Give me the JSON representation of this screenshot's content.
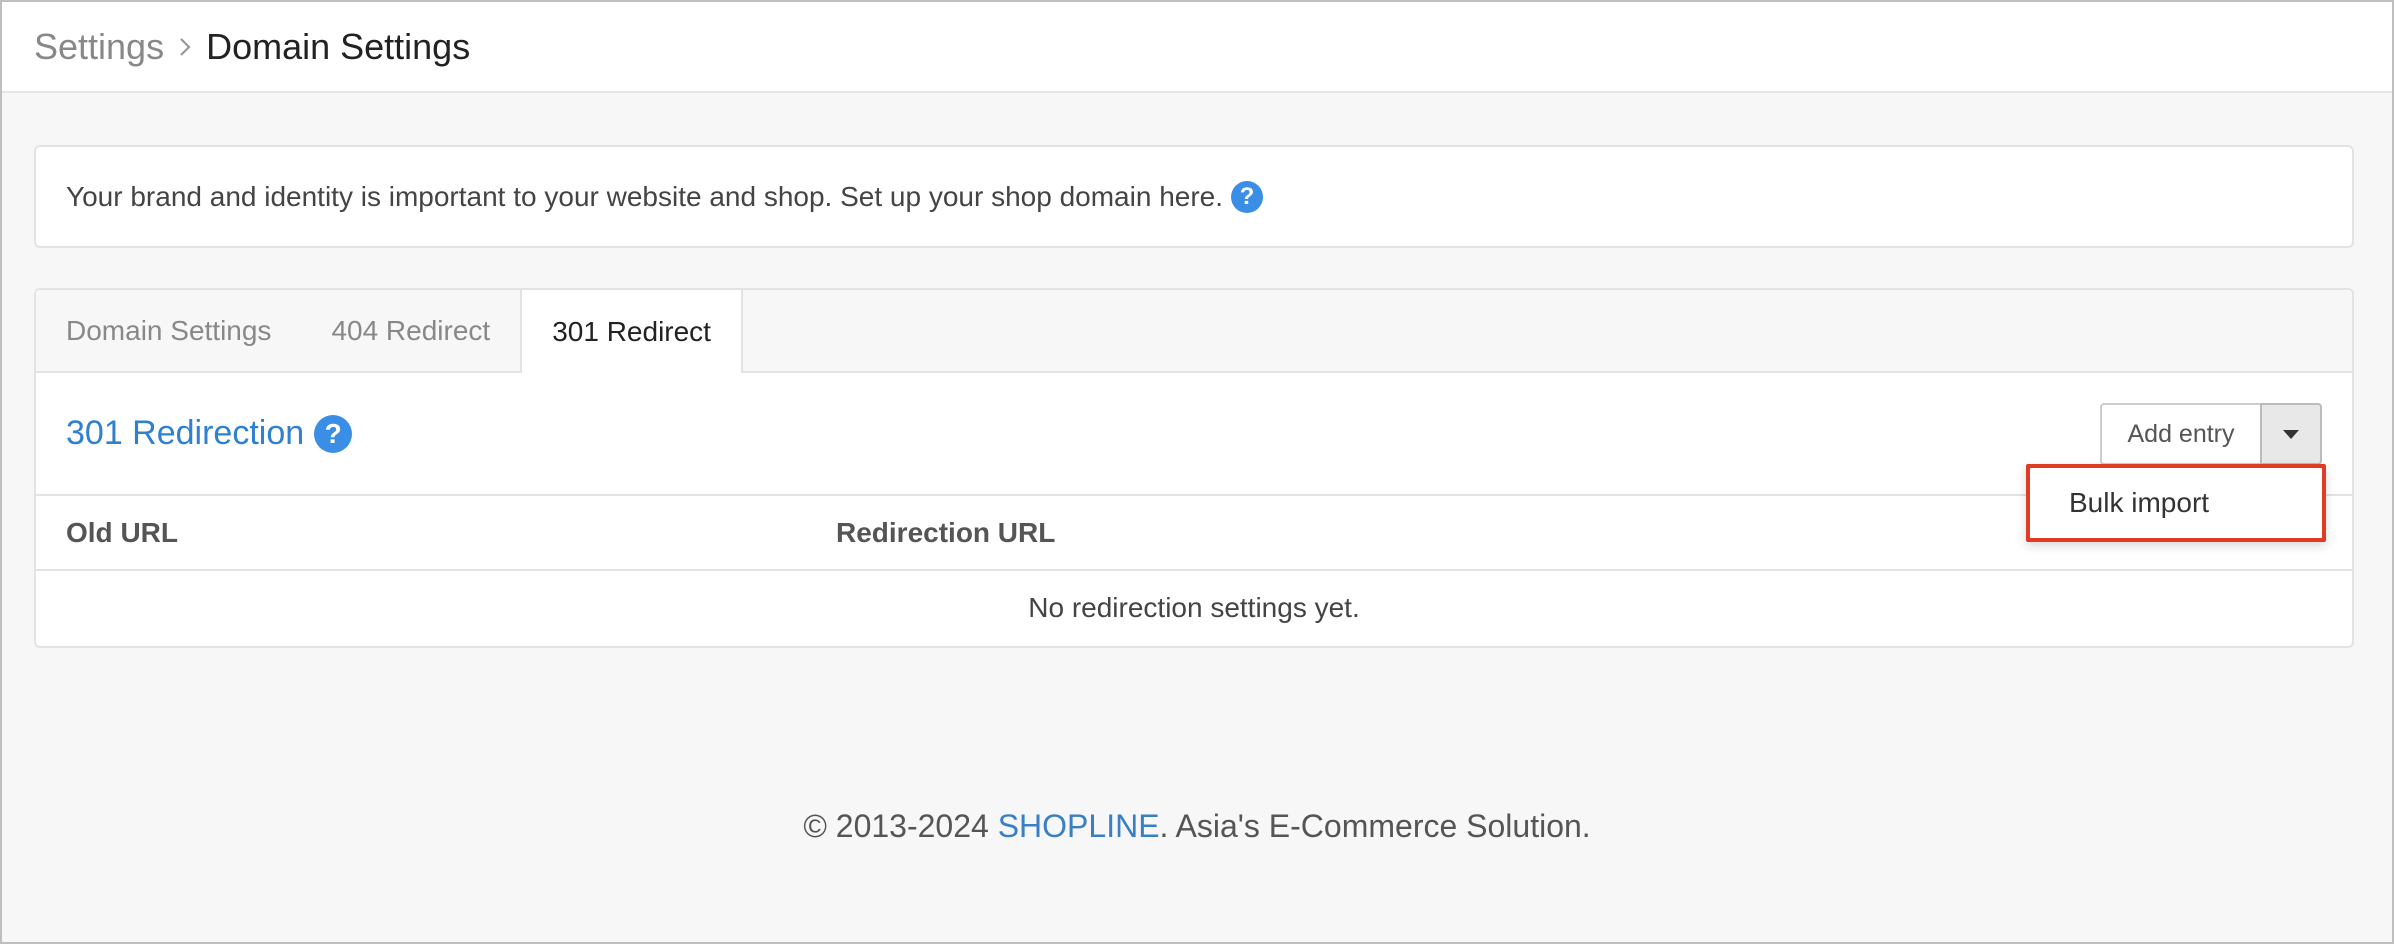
{
  "breadcrumb": {
    "parent": "Settings",
    "current": "Domain Settings"
  },
  "info": {
    "text": "Your brand and identity is important to your website and shop. Set up your shop domain here.",
    "help_glyph": "?"
  },
  "tabs": [
    {
      "label": "Domain Settings",
      "active": false
    },
    {
      "label": "404 Redirect",
      "active": false
    },
    {
      "label": "301 Redirect",
      "active": true
    }
  ],
  "section": {
    "title": "301 Redirection",
    "help_glyph": "?",
    "add_entry_label": "Add entry"
  },
  "dropdown": {
    "items": [
      "Bulk import"
    ]
  },
  "table": {
    "columns": [
      "Old URL",
      "Redirection URL"
    ],
    "empty_message": "No redirection settings yet."
  },
  "footer": {
    "prefix": "© 2013-2024 ",
    "brand": "SHOPLINE",
    "suffix": ". Asia's E-Commerce Solution."
  },
  "colors": {
    "accent_blue": "#2f80d1",
    "highlight_red": "#e03b24"
  }
}
